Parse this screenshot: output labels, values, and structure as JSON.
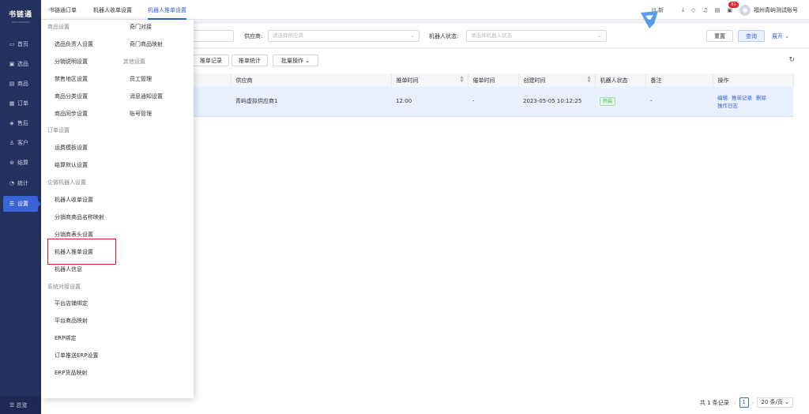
{
  "brand": {
    "name": "书链通",
    "tagline": "SHULIANTONG"
  },
  "sidebar": {
    "items": [
      {
        "icon": "▭",
        "label": "首页"
      },
      {
        "icon": "▣",
        "label": "选品"
      },
      {
        "icon": "▤",
        "label": "商品"
      },
      {
        "icon": "▦",
        "label": "订单"
      },
      {
        "icon": "◈",
        "label": "售后"
      },
      {
        "icon": "♙",
        "label": "客户"
      },
      {
        "icon": "⊛",
        "label": "结算"
      },
      {
        "icon": "◔",
        "label": "统计"
      },
      {
        "icon": "☰",
        "label": "设置"
      }
    ],
    "bottom": "☰ 总览"
  },
  "topbar": {
    "tabs": [
      "书链通订单",
      "机器人收单设置",
      "机器人推单设置"
    ],
    "right": {
      "new_label": "新",
      "badge": "81",
      "account": "福州青屿测试账号"
    }
  },
  "filters": {
    "supplier_label": "供应商:",
    "supplier_placeholder": "请选择供应商",
    "robot_status_label": "机器人状态:",
    "robot_status_placeholder": "请选择机器人状态",
    "reset": "重置",
    "search": "查询",
    "expand": "展开"
  },
  "toolbar": {
    "push_records": "推单记录",
    "push_stats": "推单统计",
    "batch": "批量操作"
  },
  "table": {
    "columns": [
      "供应商",
      "推单时间",
      "催单时间",
      "创建时间",
      "机器人状态",
      "备注",
      "操作"
    ],
    "rows": [
      {
        "supplier": "青屿虚拟供应商1",
        "push_time": "12:00",
        "urge_time": "-",
        "created": "2023-05-05 10:12:25",
        "status": "开启",
        "remark": "-",
        "actions": [
          "编辑",
          "推单记录",
          "删除",
          "操作日志"
        ]
      }
    ]
  },
  "pager": {
    "total": "共 1 条记录",
    "page": "1",
    "size": "20 条/页"
  },
  "menu": {
    "col1": [
      {
        "type": "group",
        "text": "商品设置"
      },
      {
        "type": "item",
        "text": "选品负责人设置"
      },
      {
        "type": "item",
        "text": "分销说明设置"
      },
      {
        "type": "item",
        "text": "禁售地区设置"
      },
      {
        "type": "item",
        "text": "商品分类设置"
      },
      {
        "type": "item",
        "text": "商品同步设置"
      },
      {
        "type": "group",
        "text": "订单设置"
      },
      {
        "type": "item",
        "text": "运费模板设置"
      },
      {
        "type": "item",
        "text": "结算默认设置"
      },
      {
        "type": "group",
        "text": "企微机器人设置"
      },
      {
        "type": "item",
        "text": "机器人收单设置"
      },
      {
        "type": "item",
        "text": "分销商商品名称映射"
      },
      {
        "type": "item",
        "text": "分销商表头设置"
      },
      {
        "type": "item",
        "text": "机器人推单设置"
      },
      {
        "type": "item",
        "text": "机器人信息"
      },
      {
        "type": "group",
        "text": "系统对接设置"
      },
      {
        "type": "item",
        "text": "平台店铺绑定"
      },
      {
        "type": "item",
        "text": "平台商品映射"
      },
      {
        "type": "item",
        "text": "ERP绑定"
      },
      {
        "type": "item",
        "text": "订单推送ERP设置"
      },
      {
        "type": "item",
        "text": "ERP货品映射"
      }
    ],
    "col2": [
      {
        "type": "item",
        "text": "奇门对接"
      },
      {
        "type": "item",
        "text": "奇门商品映射"
      },
      {
        "type": "group",
        "text": "其他设置"
      },
      {
        "type": "item",
        "text": "员工管理"
      },
      {
        "type": "item",
        "text": "消息通知设置"
      },
      {
        "type": "item",
        "text": "账号管理"
      }
    ]
  }
}
